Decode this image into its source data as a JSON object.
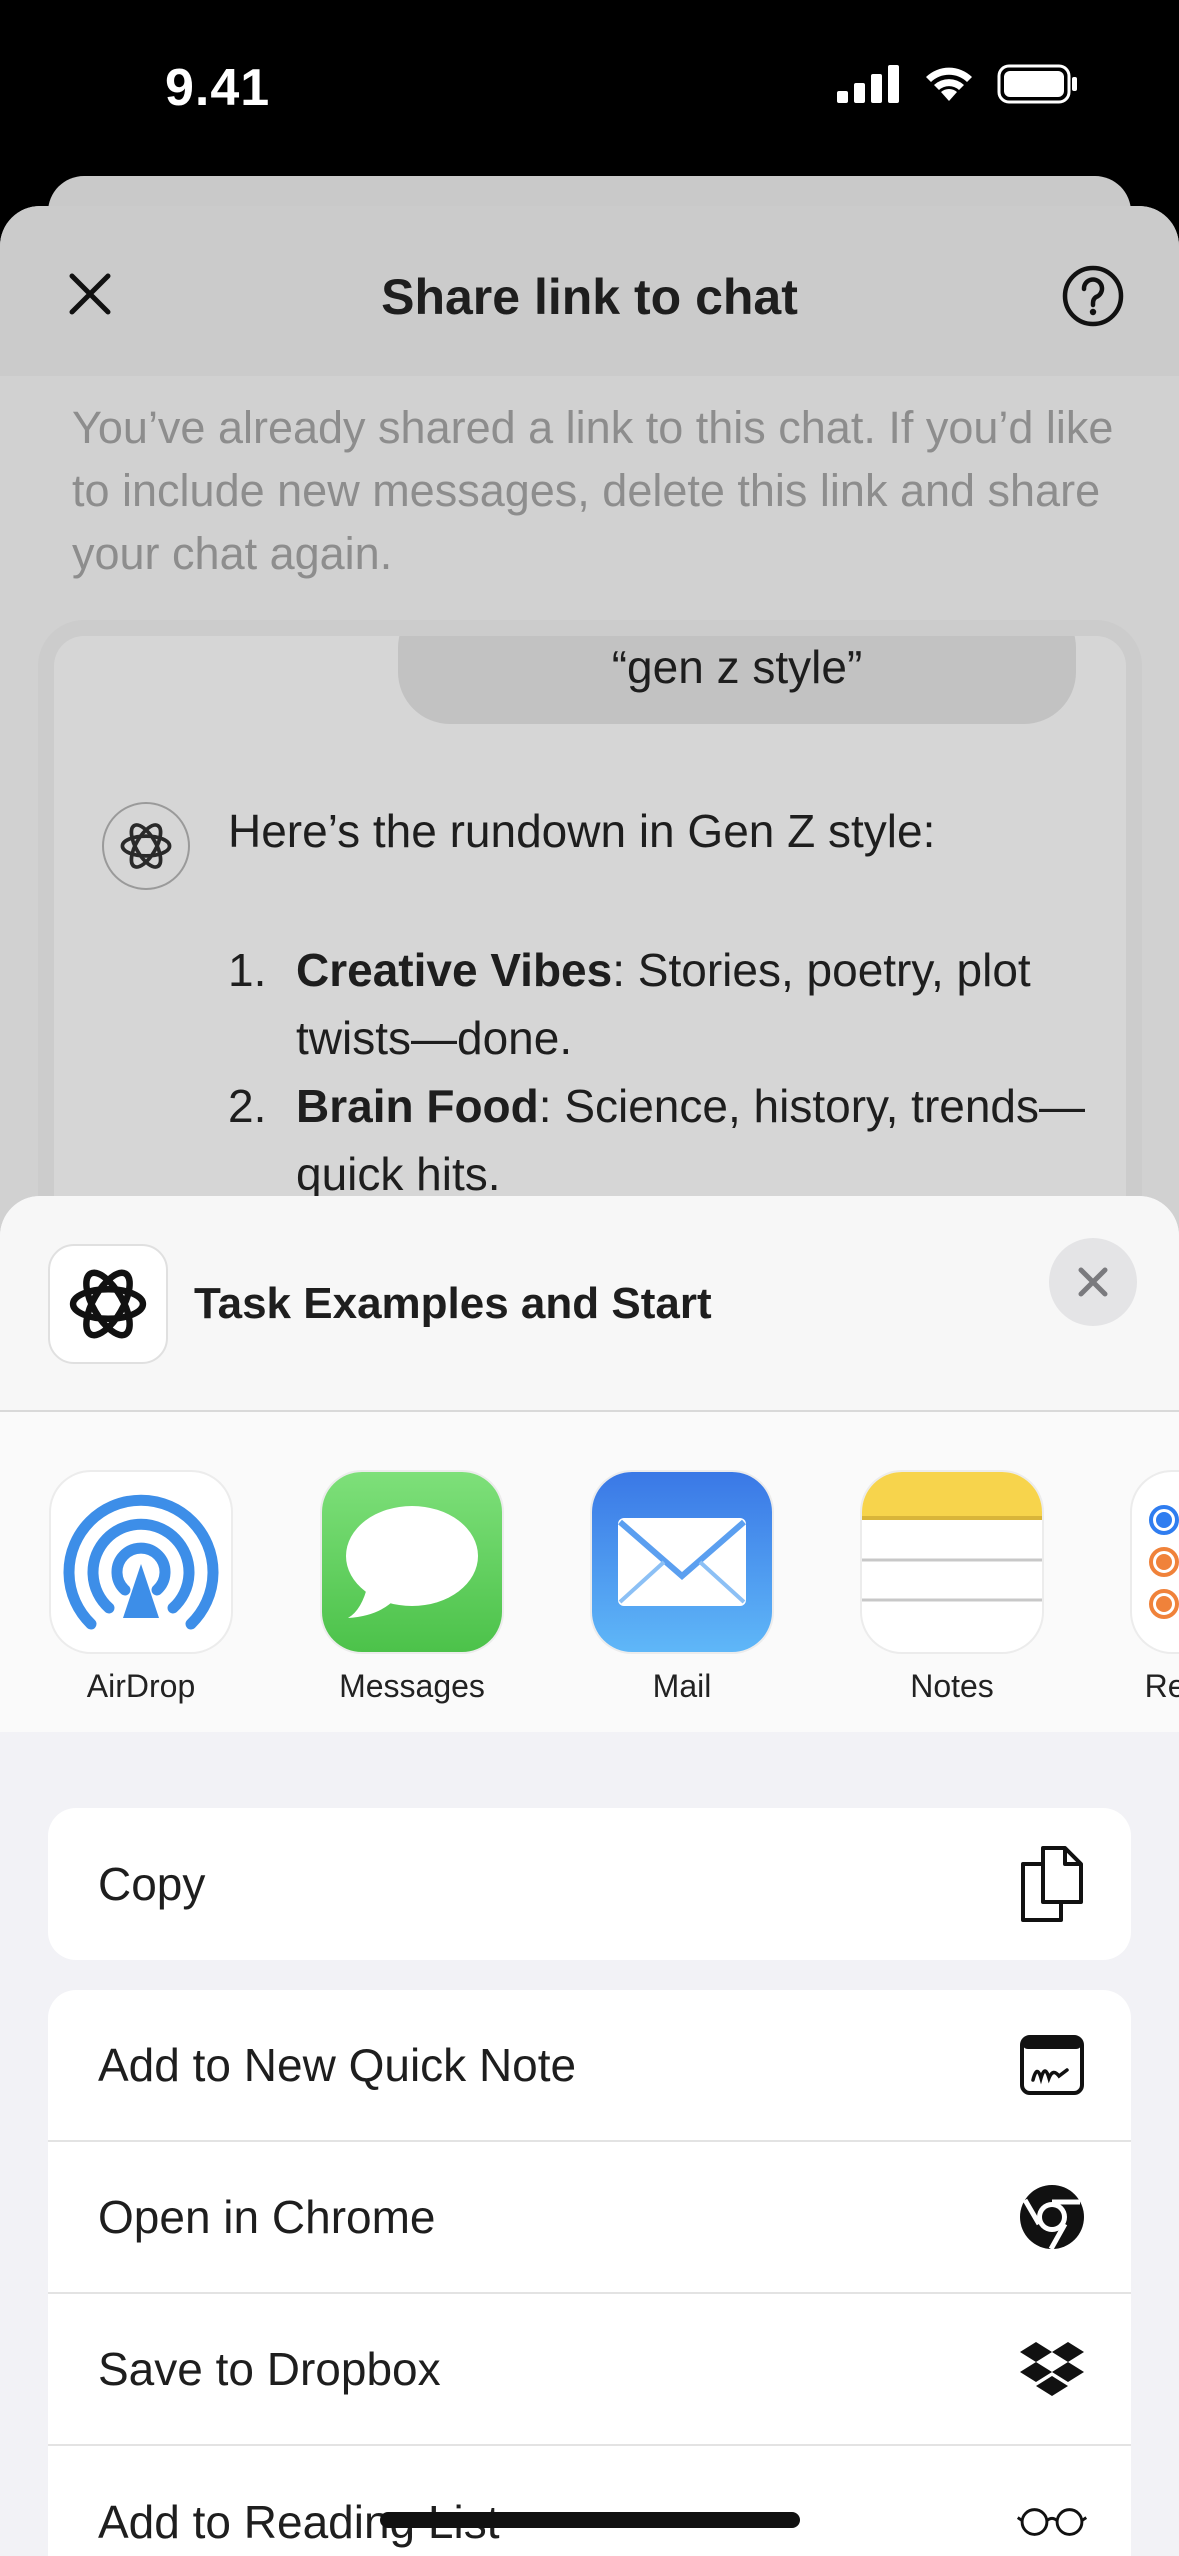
{
  "status_bar": {
    "time": "9.41"
  },
  "background_sheet": {
    "title": "Share link to chat",
    "info": "You’ve already shared a link to this chat. If you’d like to include new messages, delete this link and share your chat again.",
    "preview": {
      "user_message": "“gen z style”",
      "assistant_intro": "Here’s the rundown in Gen Z style:",
      "items": [
        {
          "num": "1.",
          "bold": "Creative Vibes",
          "rest": ": Stories, poetry, plot twists—done."
        },
        {
          "num": "2.",
          "bold": "Brain Food",
          "rest": ": Science, history, trends—quick hits."
        }
      ]
    }
  },
  "share_sheet": {
    "title": "Task Examples and Start",
    "apps": [
      {
        "label": "AirDrop",
        "icon": "airdrop-icon"
      },
      {
        "label": "Messages",
        "icon": "messages-icon"
      },
      {
        "label": "Mail",
        "icon": "mail-icon"
      },
      {
        "label": "Notes",
        "icon": "notes-icon"
      },
      {
        "label": "Reminders",
        "icon": "reminders-icon"
      }
    ],
    "copy": {
      "label": "Copy",
      "icon": "copy-icon"
    },
    "actions": [
      {
        "label": "Add to New Quick Note",
        "icon": "quick-note-icon"
      },
      {
        "label": "Open in Chrome",
        "icon": "chrome-icon"
      },
      {
        "label": "Save to Dropbox",
        "icon": "dropbox-icon"
      },
      {
        "label": "Add to Reading List",
        "icon": "glasses-icon"
      }
    ]
  },
  "colors": {
    "messages_green": "#5ac85a",
    "mail_blue": "#3f8cf0",
    "airdrop_blue": "#3d8ee8",
    "notes_yellow": "#f7d44c"
  }
}
